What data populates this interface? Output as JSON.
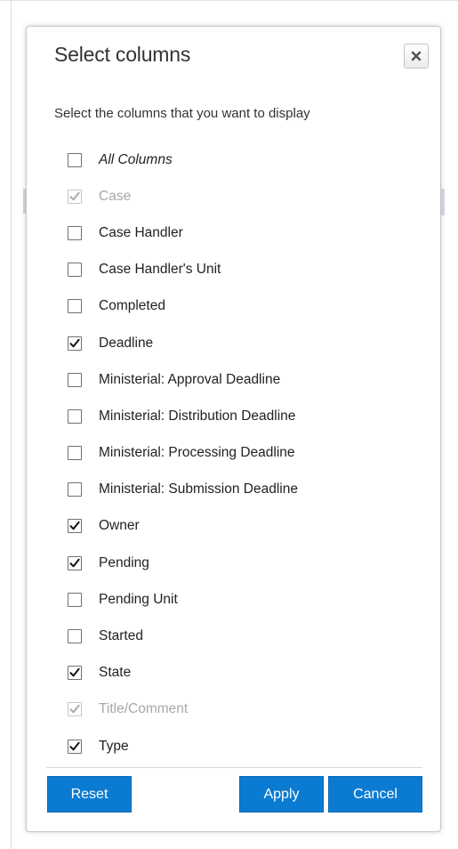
{
  "dialog": {
    "title": "Select columns",
    "close_icon": "close-x-icon",
    "instructions": "Select the columns that you want to display",
    "columns": [
      {
        "label": "All Columns",
        "checked": false,
        "disabled": false,
        "italic": true
      },
      {
        "label": "Case",
        "checked": true,
        "disabled": true,
        "italic": false
      },
      {
        "label": "Case Handler",
        "checked": false,
        "disabled": false,
        "italic": false
      },
      {
        "label": "Case Handler's Unit",
        "checked": false,
        "disabled": false,
        "italic": false
      },
      {
        "label": "Completed",
        "checked": false,
        "disabled": false,
        "italic": false
      },
      {
        "label": "Deadline",
        "checked": true,
        "disabled": false,
        "italic": false
      },
      {
        "label": "Ministerial: Approval Deadline",
        "checked": false,
        "disabled": false,
        "italic": false
      },
      {
        "label": "Ministerial: Distribution Deadline",
        "checked": false,
        "disabled": false,
        "italic": false
      },
      {
        "label": "Ministerial: Processing Deadline",
        "checked": false,
        "disabled": false,
        "italic": false
      },
      {
        "label": "Ministerial: Submission Deadline",
        "checked": false,
        "disabled": false,
        "italic": false
      },
      {
        "label": "Owner",
        "checked": true,
        "disabled": false,
        "italic": false
      },
      {
        "label": "Pending",
        "checked": true,
        "disabled": false,
        "italic": false
      },
      {
        "label": "Pending Unit",
        "checked": false,
        "disabled": false,
        "italic": false
      },
      {
        "label": "Started",
        "checked": false,
        "disabled": false,
        "italic": false
      },
      {
        "label": "State",
        "checked": true,
        "disabled": false,
        "italic": false
      },
      {
        "label": "Title/Comment",
        "checked": true,
        "disabled": true,
        "italic": false
      },
      {
        "label": "Type",
        "checked": true,
        "disabled": false,
        "italic": false
      }
    ],
    "buttons": {
      "reset": "Reset",
      "apply": "Apply",
      "cancel": "Cancel"
    }
  },
  "colors": {
    "primary_button": "#0a7bd1",
    "disabled_text": "#a8a8a8"
  }
}
